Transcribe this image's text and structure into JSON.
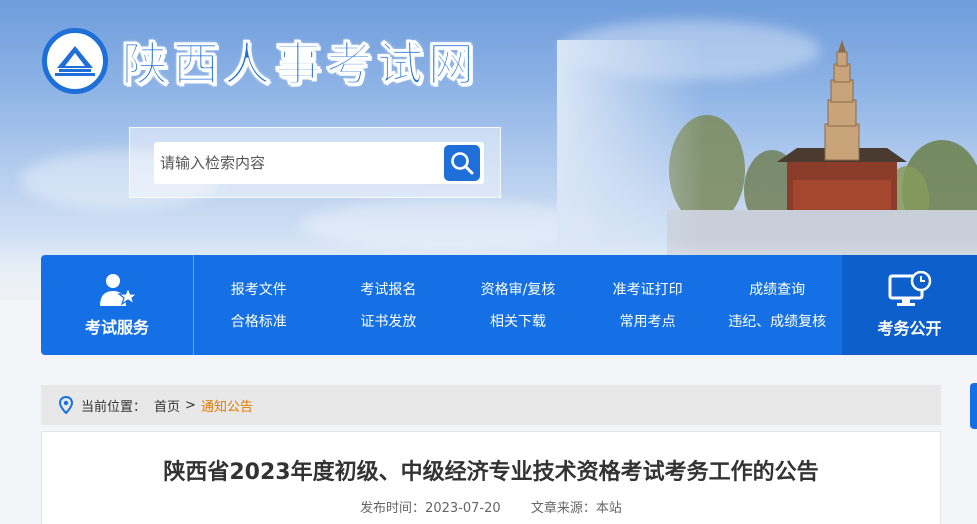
{
  "site": {
    "title": "陕西人事考试网"
  },
  "search": {
    "placeholder": "请输入检索内容"
  },
  "nav": {
    "service_label": "考试服务",
    "public_label": "考务公开",
    "links": [
      "报考文件",
      "考试报名",
      "资格审/复核",
      "准考证打印",
      "成绩查询",
      "合格标准",
      "证书发放",
      "相关下载",
      "常用考点",
      "违纪、成绩复核"
    ]
  },
  "breadcrumb": {
    "prefix": "当前位置：",
    "home": "首页",
    "separator": ">",
    "current": "通知公告"
  },
  "article": {
    "title": "陕西省2023年度初级、中级经济专业技术资格考试考务工作的公告",
    "date_label": "发布时间：",
    "date": "2023-07-20",
    "source_label": "文章来源：",
    "source": "本站"
  },
  "colors": {
    "primary": "#1470e4",
    "accent": "#e07b00"
  }
}
